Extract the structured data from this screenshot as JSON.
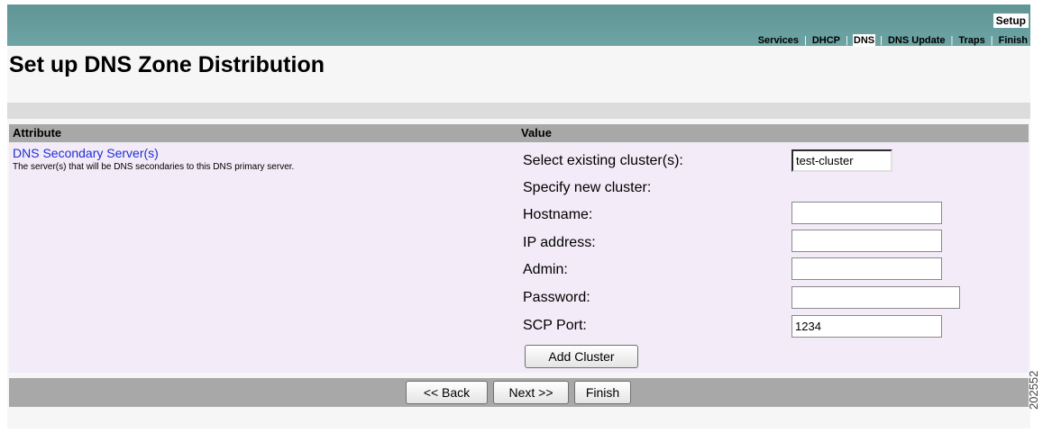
{
  "header": {
    "setup_tab": "Setup",
    "nav": [
      {
        "label": "Services",
        "active": false
      },
      {
        "label": "DHCP",
        "active": false
      },
      {
        "label": "DNS",
        "active": true
      },
      {
        "label": "DNS Update",
        "active": false
      },
      {
        "label": "Traps",
        "active": false
      },
      {
        "label": "Finish",
        "active": false
      }
    ],
    "separator": "|"
  },
  "page_title": "Set up DNS Zone Distribution",
  "table": {
    "attribute_header": "Attribute",
    "value_header": "Value"
  },
  "attribute": {
    "name": "DNS Secondary Server(s)",
    "description": "The server(s) that will be DNS secondaries to this DNS primary server."
  },
  "form": {
    "select_label": "Select existing cluster(s):",
    "select_value": "test-cluster",
    "new_cluster_label": "Specify new cluster:",
    "hostname_label": "Hostname:",
    "hostname_value": "",
    "ip_label": "IP address:",
    "ip_value": "",
    "admin_label": "Admin:",
    "admin_value": "",
    "password_label": "Password:",
    "password_value": "",
    "scp_port_label": "SCP Port:",
    "scp_port_value": "1234",
    "add_cluster_label": "Add Cluster"
  },
  "buttons": {
    "back_label": "<< Back",
    "next_label": "Next >>",
    "finish_label": "Finish"
  },
  "figure_id": "202552",
  "colors": {
    "header_teal": "#6fa4a4",
    "link_blue": "#1d2fd6",
    "content_bg": "#f3ebf7",
    "header_gray": "#a8a8a8"
  }
}
